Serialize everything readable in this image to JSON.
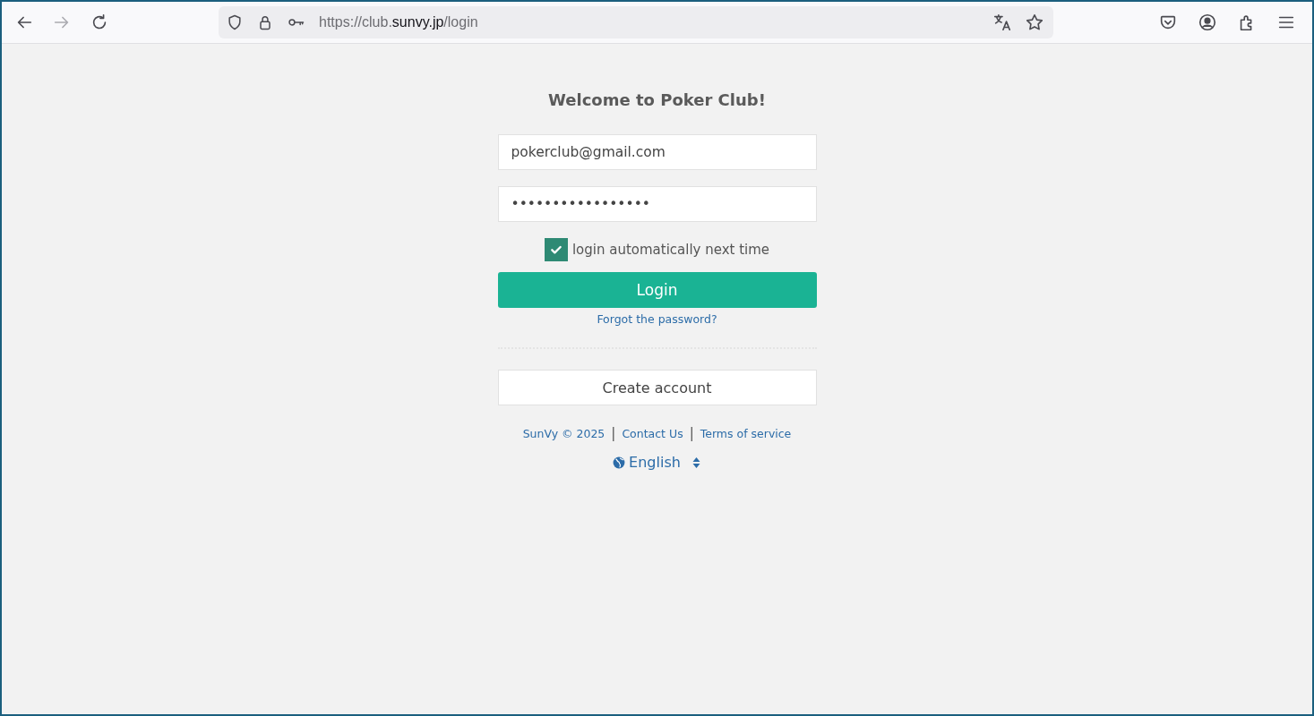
{
  "browser": {
    "url": {
      "prefix": "https://club.",
      "domain": "sunvy.jp",
      "path": "/login"
    },
    "forward_disabled": true
  },
  "login": {
    "title": "Welcome to Poker Club!",
    "email": {
      "value": "pokerclub@gmail.com"
    },
    "password": {
      "value": "•••••••••••••••••"
    },
    "remember": {
      "label": "login automatically next time",
      "checked": true
    },
    "login_button": "Login",
    "forgot_link": "Forgot the password?",
    "create_button": "Create account",
    "footer": [
      {
        "kind": "link",
        "text": "SunVy © 2025"
      },
      {
        "kind": "separator",
        "text": "|"
      },
      {
        "kind": "link",
        "text": "Contact Us"
      },
      {
        "kind": "separator",
        "text": "|"
      },
      {
        "kind": "link",
        "text": "Terms of service"
      }
    ],
    "language": "English"
  }
}
